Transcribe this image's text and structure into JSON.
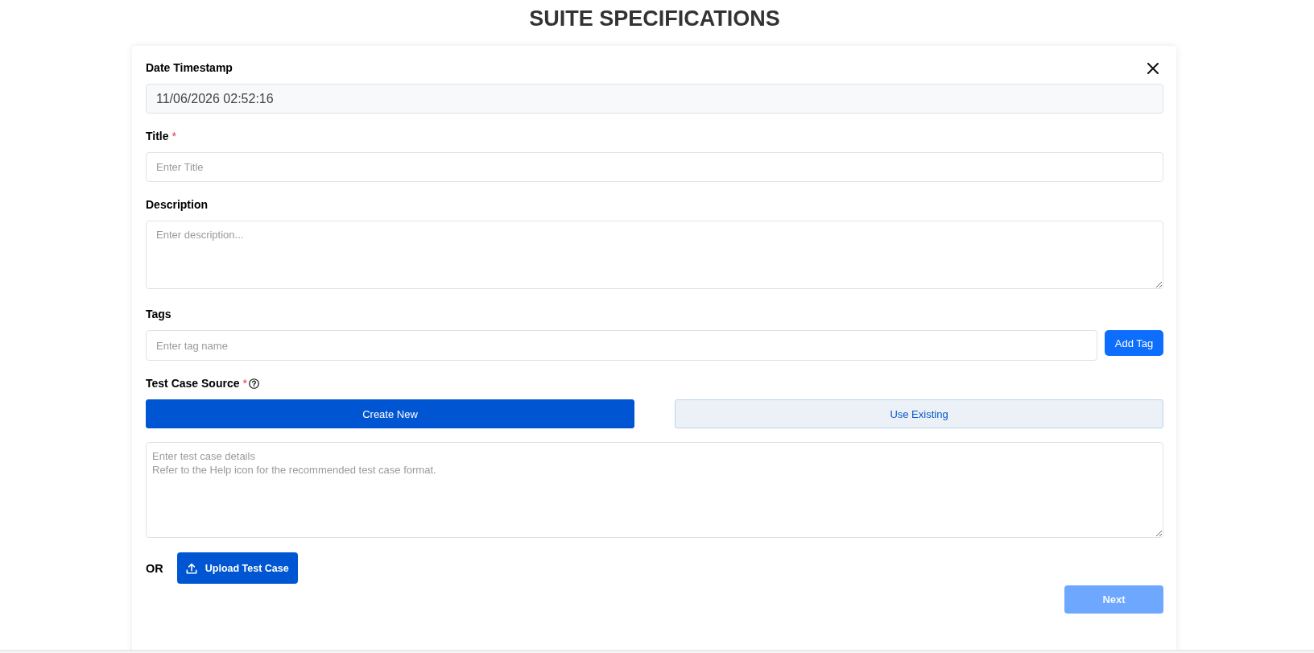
{
  "page": {
    "title": "SUITE SPECIFICATIONS"
  },
  "form": {
    "fields": [
      {
        "kind": "readonly",
        "label": "Date Timestamp",
        "value": "11/06/2026 02:52:16"
      },
      {
        "kind": "input",
        "label": "Title",
        "required_mark": "*",
        "placeholder": "Enter Title"
      },
      {
        "kind": "textarea",
        "label": "Description",
        "placeholder": "Enter description..."
      },
      {
        "kind": "tags",
        "label": "Tags",
        "placeholder": "Enter tag name",
        "button": "Add Tag"
      }
    ],
    "test_case_source": {
      "label": "Test Case Source",
      "required_mark": "*",
      "options": [
        {
          "label": "Create New",
          "selected": true
        },
        {
          "label": "Use Existing",
          "selected": false
        }
      ],
      "details_placeholder": "Enter test case details\nRefer to the Help icon for the recommended test case format.",
      "or_label": "OR",
      "upload_button": "Upload Test Case"
    },
    "next_button": {
      "label": "Next",
      "disabled": true
    }
  }
}
